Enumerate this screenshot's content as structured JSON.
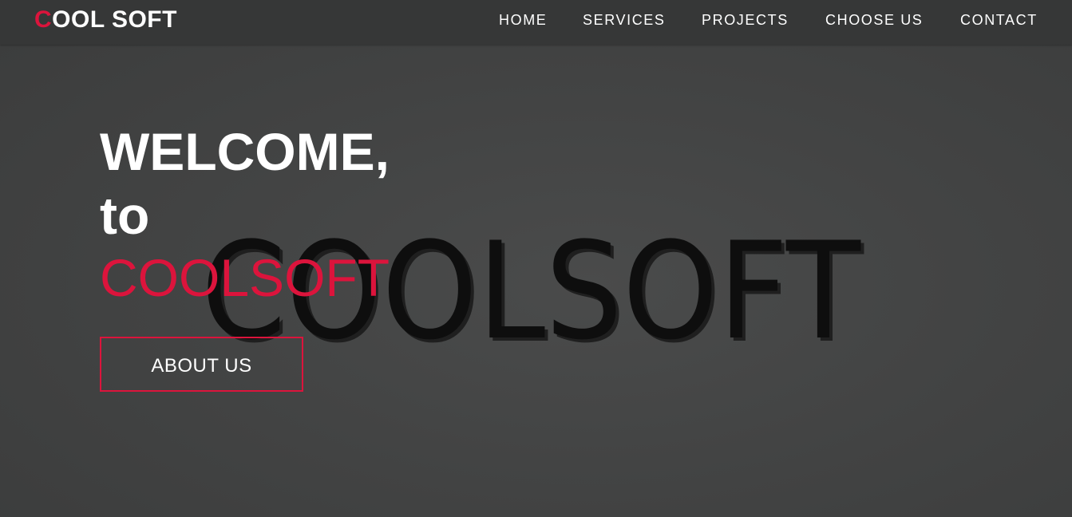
{
  "navbar": {
    "logo_first_letter": "C",
    "logo_rest": "OOL SOFT",
    "links": [
      {
        "label": "HOME"
      },
      {
        "label": "SERVICES"
      },
      {
        "label": "PROJECTS"
      },
      {
        "label": "CHOOSE US"
      },
      {
        "label": "CONTACT"
      }
    ]
  },
  "hero": {
    "line1": "WELCOME,",
    "line2": "to",
    "brand": "COOLSOFT",
    "button_label": "ABOUT US",
    "background_3d_text": "COOLSOFT"
  },
  "colors": {
    "accent": "#dc143c",
    "background": "#434444",
    "navbar": "#363737",
    "text": "#ffffff"
  }
}
